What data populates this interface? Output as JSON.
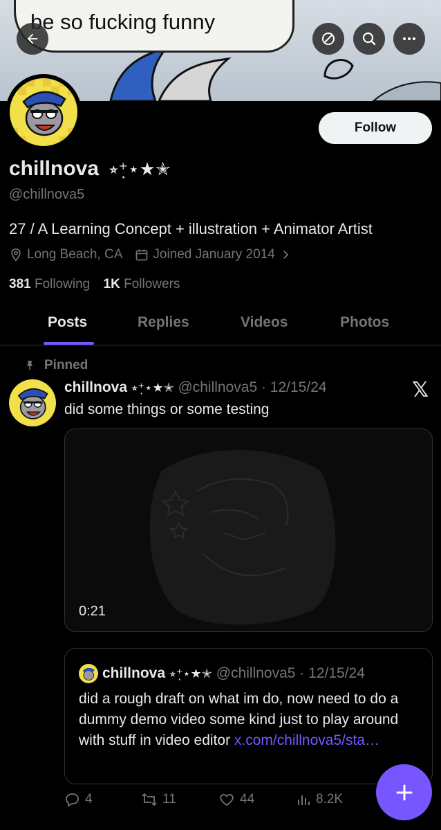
{
  "banner": {
    "caption": "be so fucking funny"
  },
  "header": {
    "follow_label": "Follow"
  },
  "profile": {
    "name": "chillnova",
    "name_decor": "⭒⁺̣⋆★✭",
    "handle": "@chillnova5",
    "bio": "27 / A Learning Concept + illustration + Animator Artist",
    "location": "Long Beach, CA",
    "joined": "Joined January 2014",
    "following_count": "381",
    "following_label": "Following",
    "followers_count": "1K",
    "followers_label": "Followers"
  },
  "tabs": [
    {
      "label": "Posts"
    },
    {
      "label": "Replies"
    },
    {
      "label": "Videos"
    },
    {
      "label": "Photos"
    }
  ],
  "post": {
    "pinned_label": "Pinned",
    "name": "chillnova",
    "name_decor": "⭒⁺̣⋆★✭",
    "handle_date": "@chillnova5 · 12/15/24",
    "text": "did some things or some testing",
    "video_time": "0:21",
    "quote": {
      "name": "chillnova",
      "name_decor": "⭒⁺̣⋆★✭",
      "handle_date": "@chillnova5 · 12/15/24",
      "text": "did a rough draft on what im do, now need to do a dummy demo video some kind just to play around with stuff in video editor ",
      "link": "x.com/chillnova5/sta…"
    },
    "actions": {
      "replies": "4",
      "reposts": "11",
      "likes": "44",
      "views": "8.2K"
    }
  },
  "colors": {
    "accent": "#7856ff",
    "muted": "#71767b",
    "text": "#e7e9ea",
    "bg": "#000000"
  }
}
